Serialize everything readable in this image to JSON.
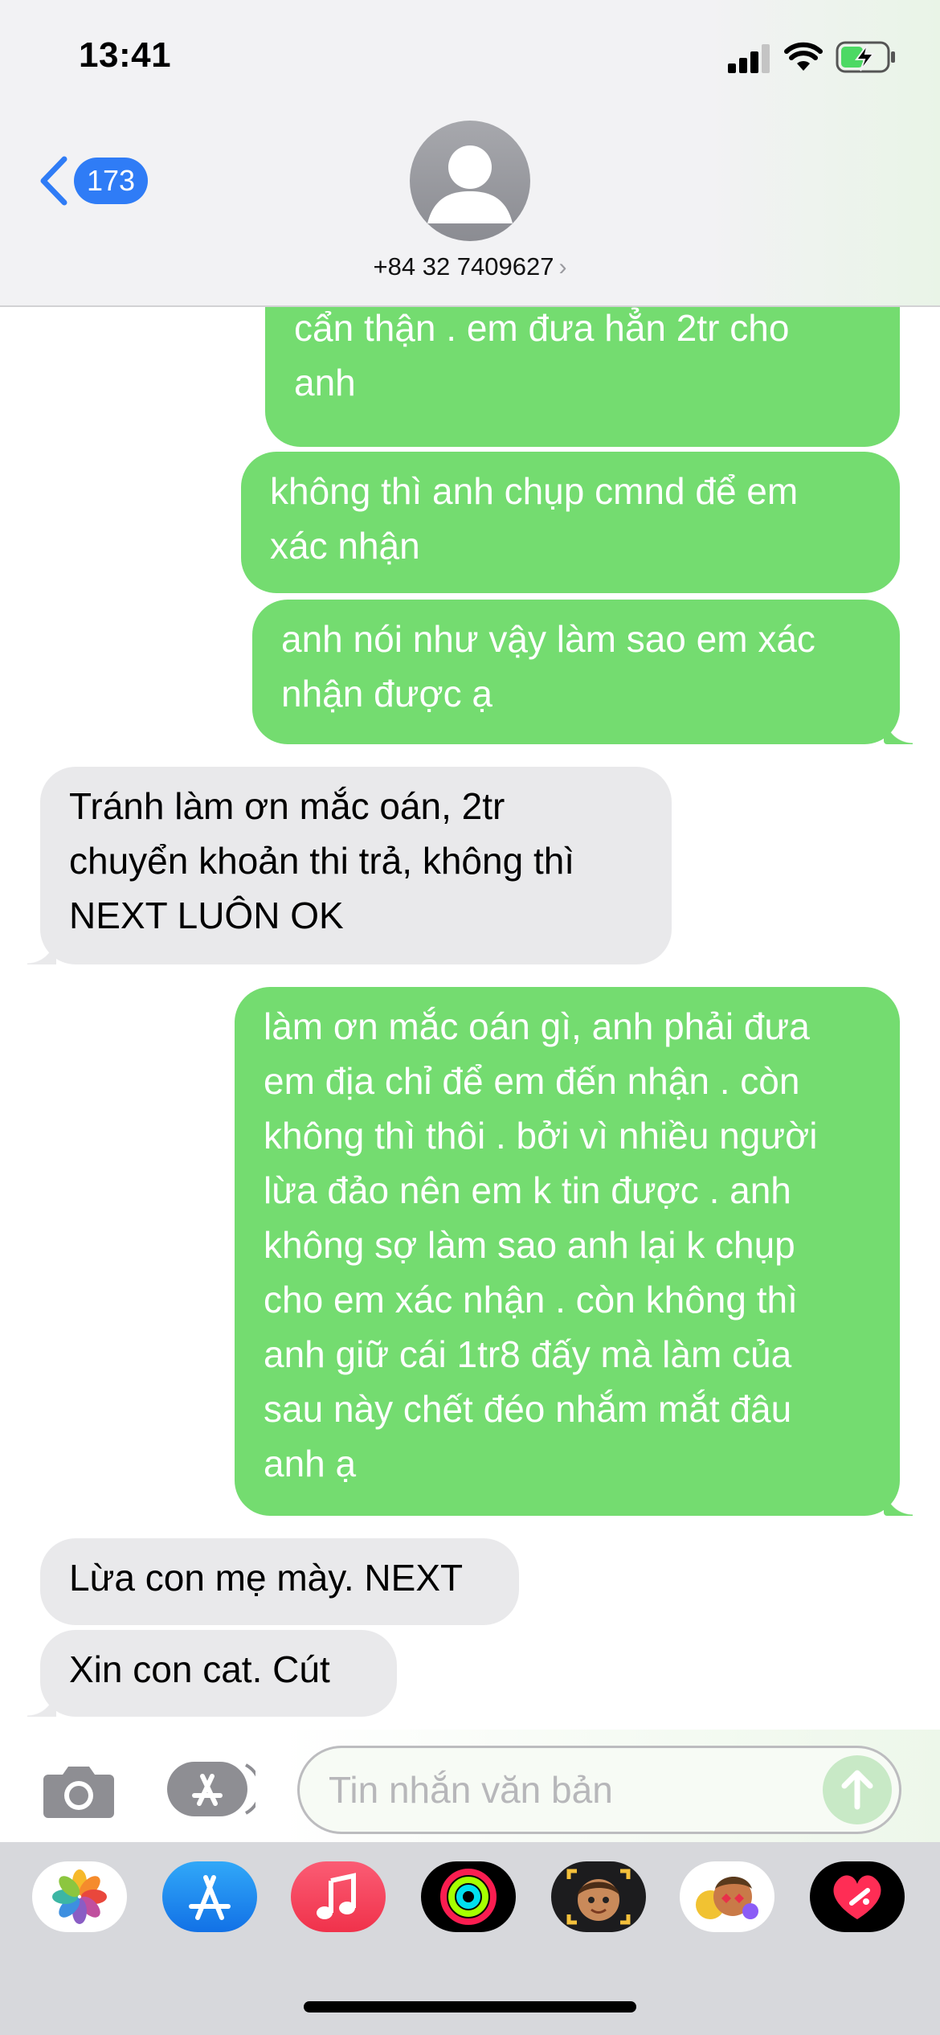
{
  "status": {
    "time": "13:41"
  },
  "header": {
    "back_count": "173",
    "contact": "+84 32 7409627",
    "chevron": "›"
  },
  "messages": [
    {
      "dir": "out",
      "lines": [
        "cẩn thận . em đưa hẳn 2tr cho",
        "anh"
      ],
      "tail": false
    },
    {
      "dir": "out",
      "lines": [
        "không thì anh chụp cmnd để em",
        "xác nhận"
      ],
      "tail": false
    },
    {
      "dir": "out",
      "lines": [
        "anh nói như vậy làm sao em xác",
        "nhận được ạ"
      ],
      "tail": true
    },
    {
      "dir": "in",
      "lines": [
        "Tránh làm ơn mắc oán, 2tr",
        "chuyển khoản thi trả, không thì",
        "NEXT LUÔN OK"
      ],
      "tail": true
    },
    {
      "dir": "out",
      "lines": [
        "làm ơn mắc oán gì, anh phải đưa",
        "em địa chỉ để em đến nhận . còn",
        "không thì thôi . bởi vì nhiều người",
        "lừa đảo nên em k tin được . anh",
        "không sợ làm sao anh lại k chụp",
        "cho em xác nhận . còn không thì",
        "anh giữ cái 1tr8 đấy mà làm của",
        "sau này chết đéo nhắm mắt đâu",
        "anh ạ"
      ],
      "tail": true
    },
    {
      "dir": "in",
      "lines": [
        "Lừa con mẹ mày. NEXT"
      ],
      "tail": false
    },
    {
      "dir": "in",
      "lines": [
        "Xin con cat. Cút"
      ],
      "tail": true
    }
  ],
  "composer": {
    "placeholder": "Tin nhắn văn bản"
  },
  "drawer": {
    "apps": [
      "photos-app",
      "app-store-app",
      "music-app",
      "activity-app",
      "memoji-app",
      "animoji-app",
      "digital-touch-app"
    ]
  },
  "colors": {
    "outgoing": "#74dc70",
    "incoming": "#e9e9eb",
    "accent": "#2f7cf6"
  }
}
